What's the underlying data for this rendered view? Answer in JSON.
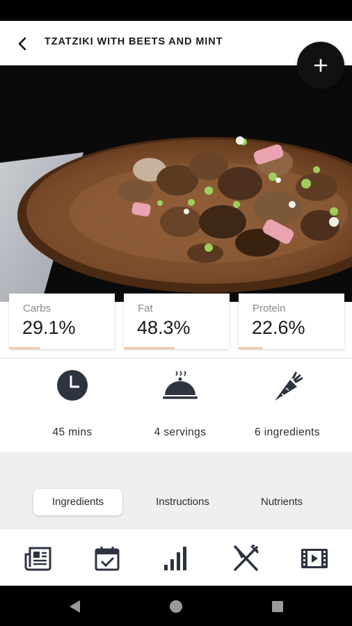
{
  "header": {
    "title": "TZATZIKI WITH BEETS AND MINT",
    "back_icon": "chevron-left-icon",
    "add_icon": "plus-icon"
  },
  "macros": [
    {
      "label": "Carbs",
      "value": "29.1%",
      "fraction": 0.291
    },
    {
      "label": "Fat",
      "value": "48.3%",
      "fraction": 0.483
    },
    {
      "label": "Protein",
      "value": "22.6%",
      "fraction": 0.226
    }
  ],
  "stats": [
    {
      "icon": "clock-icon",
      "text": "45 mins"
    },
    {
      "icon": "serving-cloche-icon",
      "text": "4 servings"
    },
    {
      "icon": "carrot-icon",
      "text": "6 ingredients"
    }
  ],
  "tabs": [
    {
      "label": "Ingredients",
      "active": true
    },
    {
      "label": "Instructions",
      "active": false
    },
    {
      "label": "Nutrients",
      "active": false
    }
  ],
  "bottom_nav": [
    {
      "icon": "newspaper-icon"
    },
    {
      "icon": "calendar-check-icon"
    },
    {
      "icon": "bar-chart-icon"
    },
    {
      "icon": "fork-knife-icon"
    },
    {
      "icon": "film-icon"
    }
  ],
  "system_nav": [
    {
      "icon": "back-triangle-icon"
    },
    {
      "icon": "home-circle-icon"
    },
    {
      "icon": "recents-square-icon"
    }
  ],
  "colors": {
    "icon_dark": "#2d3340",
    "accent_bar": "#f2c9a8",
    "gray_band": "#efefef"
  }
}
